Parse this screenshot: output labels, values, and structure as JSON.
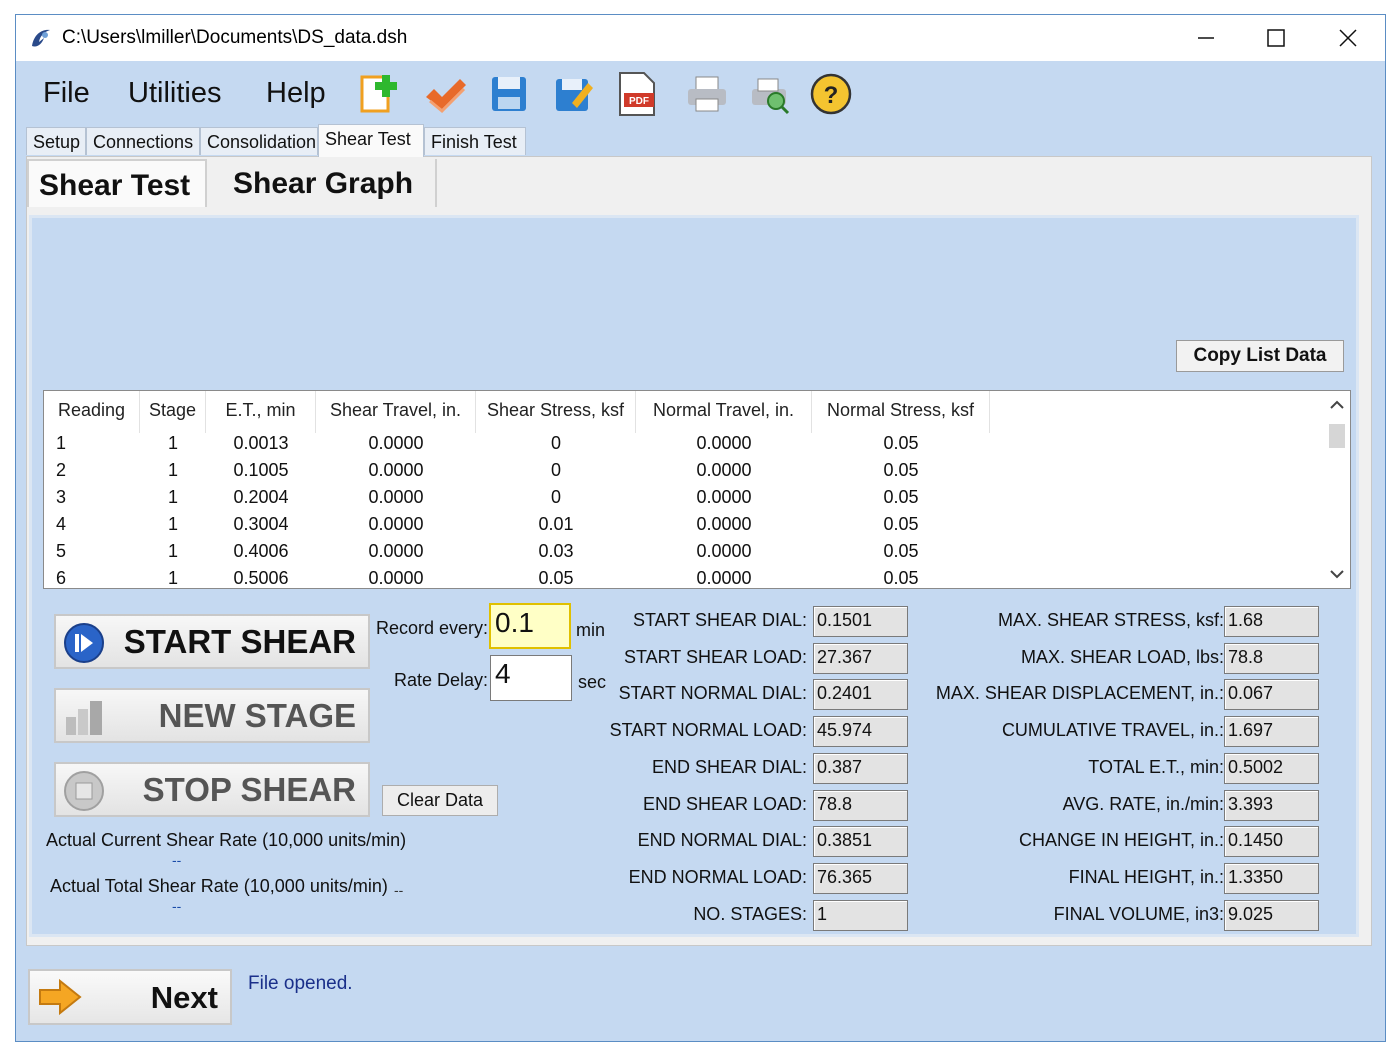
{
  "window": {
    "title": "C:\\Users\\lmiller\\Documents\\DS_data.dsh"
  },
  "menu": {
    "file": "File",
    "utilities": "Utilities",
    "help": "Help"
  },
  "toolbar_icons": [
    "new-file-icon",
    "check-icon",
    "save-icon",
    "save-edit-icon",
    "pdf-icon",
    "print-icon",
    "print-preview-icon",
    "help-icon"
  ],
  "toolbar_pdf_label": "PDF",
  "tabs": [
    "Setup",
    "Connections",
    "Consolidation",
    "Shear Test",
    "Finish Test"
  ],
  "active_tab": "Shear Test",
  "subtabs": [
    "Shear Test",
    "Shear Graph"
  ],
  "copy_list_label": "Copy List Data",
  "table": {
    "columns": [
      "Reading",
      "Stage",
      "E.T., min",
      "Shear Travel, in.",
      "Shear Stress, ksf",
      "Normal Travel, in.",
      "Normal Stress, ksf"
    ],
    "rows": [
      [
        "1",
        "1",
        "0.0013",
        "0.0000",
        "0",
        "0.0000",
        "0.05"
      ],
      [
        "2",
        "1",
        "0.1005",
        "0.0000",
        "0",
        "0.0000",
        "0.05"
      ],
      [
        "3",
        "1",
        "0.2004",
        "0.0000",
        "0",
        "0.0000",
        "0.05"
      ],
      [
        "4",
        "1",
        "0.3004",
        "0.0000",
        "0.01",
        "0.0000",
        "0.05"
      ],
      [
        "5",
        "1",
        "0.4006",
        "0.0000",
        "0.03",
        "0.0000",
        "0.05"
      ],
      [
        "6",
        "1",
        "0.5006",
        "0.0000",
        "0.05",
        "0.0000",
        "0.05"
      ]
    ]
  },
  "controls": {
    "start_shear": "START SHEAR",
    "new_stage": "NEW STAGE",
    "stop_shear": "STOP SHEAR",
    "record_every_label": "Record every:",
    "record_every_value": "0.1",
    "record_every_unit": "min",
    "rate_delay_label": "Rate Delay:",
    "rate_delay_value": "4",
    "rate_delay_unit": "sec",
    "clear_data": "Clear Data",
    "actual_current_rate_label": "Actual Current Shear Rate (10,000 units/min)",
    "actual_current_rate_value": "--",
    "actual_total_rate_label": "Actual Total Shear Rate (10,000 units/min)",
    "actual_total_rate_value": "--",
    "extra_dash": "--"
  },
  "fields_left": [
    {
      "label": "START SHEAR DIAL:",
      "value": "0.1501"
    },
    {
      "label": "START SHEAR LOAD:",
      "value": "27.367"
    },
    {
      "label": "START NORMAL DIAL:",
      "value": "0.2401"
    },
    {
      "label": "START NORMAL LOAD:",
      "value": "45.974"
    },
    {
      "label": "END SHEAR DIAL:",
      "value": "0.387"
    },
    {
      "label": "END SHEAR LOAD:",
      "value": "78.8"
    },
    {
      "label": "END NORMAL DIAL:",
      "value": "0.3851"
    },
    {
      "label": "END NORMAL LOAD:",
      "value": "76.365"
    },
    {
      "label": "NO. STAGES:",
      "value": "1"
    }
  ],
  "fields_right": [
    {
      "label": "MAX. SHEAR STRESS, ksf:",
      "value": "1.68"
    },
    {
      "label": "MAX. SHEAR LOAD, lbs:",
      "value": "78.8"
    },
    {
      "label": "MAX. SHEAR DISPLACEMENT, in.:",
      "value": "0.067"
    },
    {
      "label": "CUMULATIVE TRAVEL, in.:",
      "value": "1.697"
    },
    {
      "label": "TOTAL E.T., min:",
      "value": "0.5002"
    },
    {
      "label": "AVG. RATE, in./min:",
      "value": "3.393"
    },
    {
      "label": "CHANGE IN HEIGHT, in.:",
      "value": "0.1450"
    },
    {
      "label": "FINAL HEIGHT, in.:",
      "value": "1.3350"
    },
    {
      "label": "FINAL VOLUME, in3:",
      "value": "9.025"
    }
  ],
  "footer": {
    "next_label": "Next",
    "status": "File opened."
  }
}
